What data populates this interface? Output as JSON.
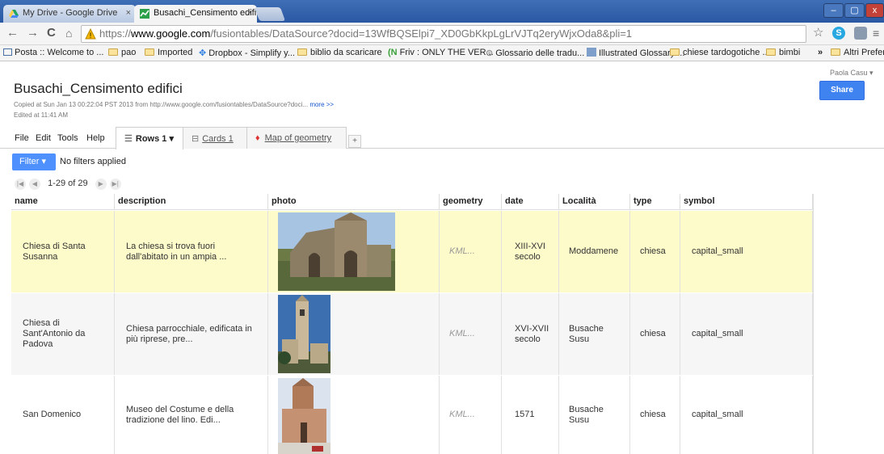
{
  "browser": {
    "tabs": [
      {
        "label": "My Drive - Google Drive",
        "close": "×"
      },
      {
        "label": "Busachi_Censimento edifi",
        "close": "×"
      }
    ],
    "url_scheme": "https://",
    "url_host": "www.google.com",
    "url_path": "/fusiontables/DataSource?docid=13WfBQSElpi7_XD0GbKkpLgLrVJTq2eryWjxOda8&pli=1",
    "bookmarks": [
      "Posta :: Welcome to ...",
      "pao",
      "Imported",
      "Dropbox - Simplify y...",
      "biblio da scaricare",
      "Friv : ONLY THE VER...",
      "Glossario delle tradu...",
      "Illustrated Glossary ...",
      "chiese tardogotiche ...",
      "bimbi",
      "Altri Preferi"
    ],
    "bookmarks_more": "»"
  },
  "app": {
    "title": "Busachi_Censimento edifici",
    "copied": "Copied at Sun Jan 13 00:22:04 PST 2013 from http://www.google.com/fusiontables/DataSource?doci...",
    "more_link": "more >>",
    "edited": "Edited at 11:41 AM",
    "user": "Paola Casu ▾",
    "share": "Share",
    "menus": [
      "File",
      "Edit",
      "Tools",
      "Help"
    ],
    "view_tabs": [
      {
        "label": "Rows 1 ▾"
      },
      {
        "label": "Cards 1"
      },
      {
        "label": "Map of geometry"
      }
    ],
    "add_tab": "+",
    "filter": "Filter ▾",
    "filter_status": "No filters applied",
    "pager": "1-29 of 29"
  },
  "table": {
    "columns": [
      "name",
      "description",
      "photo",
      "geometry",
      "date",
      "Località",
      "type",
      "symbol"
    ],
    "rows": [
      {
        "name": "Chiesa di Santa Susanna",
        "description": "La chiesa si trova fuori dall'abitato in un ampia ...",
        "geometry": "KML...",
        "date": "XIII-XVI secolo",
        "localita": "Moddamene",
        "type": "chiesa",
        "symbol": "capital_small"
      },
      {
        "name": "Chiesa di Sant'Antonio da Padova",
        "description": "Chiesa parrocchiale, edificata in più riprese, pre...",
        "geometry": "KML...",
        "date": "XVI-XVII secolo",
        "localita": "Busache Susu",
        "type": "chiesa",
        "symbol": "capital_small"
      },
      {
        "name": "San Domenico",
        "description": "Museo del Costume e della tradizione del lino. Edi...",
        "geometry": "KML...",
        "date": "1571",
        "localita": "Busache Susu",
        "type": "chiesa",
        "symbol": "capital_small"
      }
    ]
  },
  "colors": {
    "highlight_row": "#fdfbc9",
    "alt_row": "#f6f6f6",
    "accent": "#4d90fe"
  }
}
